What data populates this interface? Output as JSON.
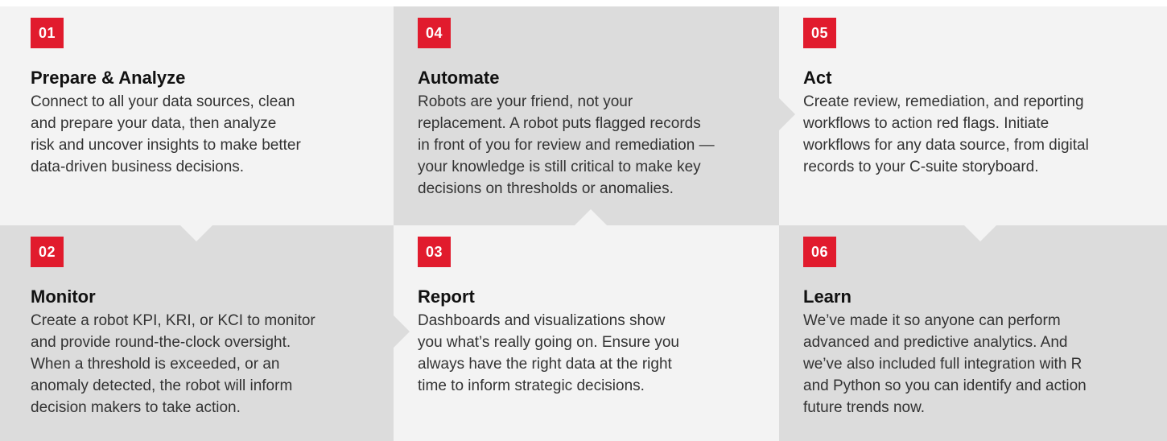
{
  "colors": {
    "badge": "#e11b2d",
    "light_panel": "#f3f3f3",
    "dark_panel": "#dcdcdc"
  },
  "steps": [
    {
      "number": "01",
      "title": "Prepare & Analyze",
      "lines": [
        "Connect to all your data sources, clean",
        "and prepare your data, then analyze",
        "risk and uncover insights to make better",
        "data-driven business decisions."
      ]
    },
    {
      "number": "04",
      "title": "Automate",
      "lines": [
        "Robots are your friend, not your",
        "replacement. A robot puts flagged records",
        "in front of you for review and remediation —",
        "your knowledge is still critical to make key",
        "decisions on thresholds or anomalies."
      ]
    },
    {
      "number": "05",
      "title": "Act",
      "lines": [
        "Create review, remediation, and reporting",
        "workflows to action red flags. Initiate",
        "workflows for any data source, from digital",
        "records to your C-suite storyboard."
      ]
    },
    {
      "number": "02",
      "title": "Monitor",
      "lines": [
        "Create a robot KPI, KRI, or KCI to monitor",
        "and provide round-the-clock oversight.",
        "When a threshold is exceeded, or an",
        "anomaly detected, the robot will inform",
        "decision makers to take action."
      ]
    },
    {
      "number": "03",
      "title": "Report",
      "lines": [
        "Dashboards and visualizations show",
        "you what’s really going on. Ensure you",
        "always have the right data at the right",
        "time to inform strategic decisions."
      ]
    },
    {
      "number": "06",
      "title": "Learn",
      "lines": [
        "We’ve made it so anyone can perform",
        "advanced and predictive analytics. And",
        "we’ve also included full integration with R",
        "and Python so you can identify and action",
        "future trends now."
      ]
    }
  ]
}
